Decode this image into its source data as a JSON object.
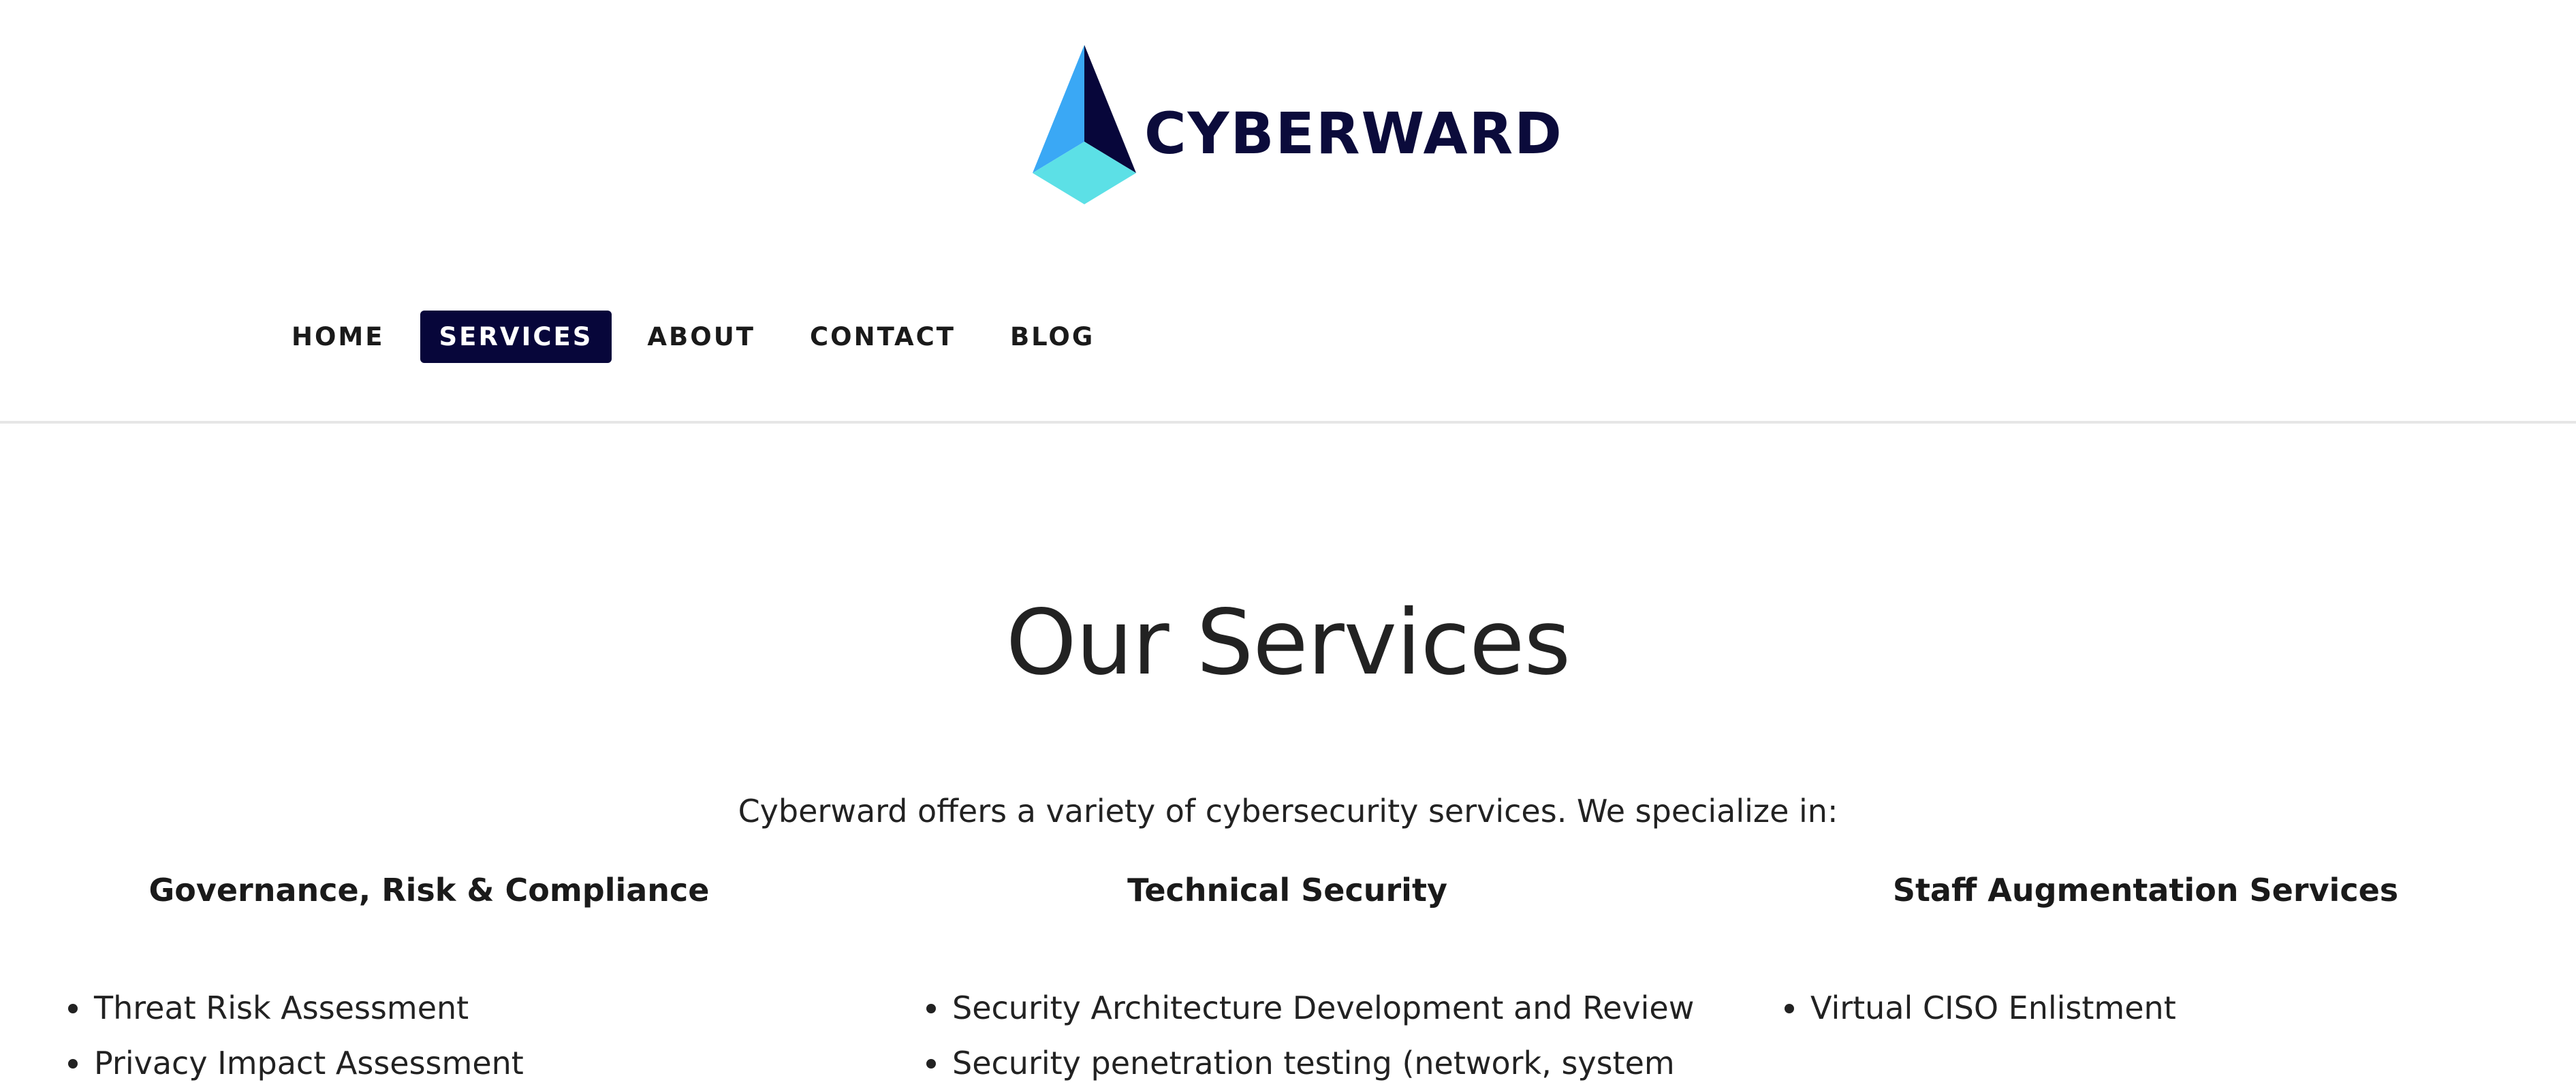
{
  "header": {
    "logo_text": "CYBERWARD",
    "brand_colors": {
      "dark": "#07063a",
      "blue": "#3aa8f5",
      "cyan": "#5ce0e6"
    },
    "nav": [
      {
        "label": "HOME",
        "active": false
      },
      {
        "label": "SERVICES",
        "active": true
      },
      {
        "label": "ABOUT",
        "active": false
      },
      {
        "label": "CONTACT",
        "active": false
      },
      {
        "label": "BLOG",
        "active": false
      }
    ]
  },
  "main": {
    "title": "Our Services",
    "intro": "Cyberward offers a variety of cybersecurity services. We specialize in:",
    "columns": [
      {
        "heading": "Governance, Risk & Compliance",
        "items": [
          "Threat Risk Assessment",
          "Privacy Impact Assessment"
        ]
      },
      {
        "heading": "Technical Security",
        "items": [
          "Security Architecture Development and Review",
          "Security penetration testing (network, system"
        ]
      },
      {
        "heading": "Staff Augmentation Services",
        "items": [
          "Virtual CISO Enlistment"
        ]
      }
    ]
  }
}
